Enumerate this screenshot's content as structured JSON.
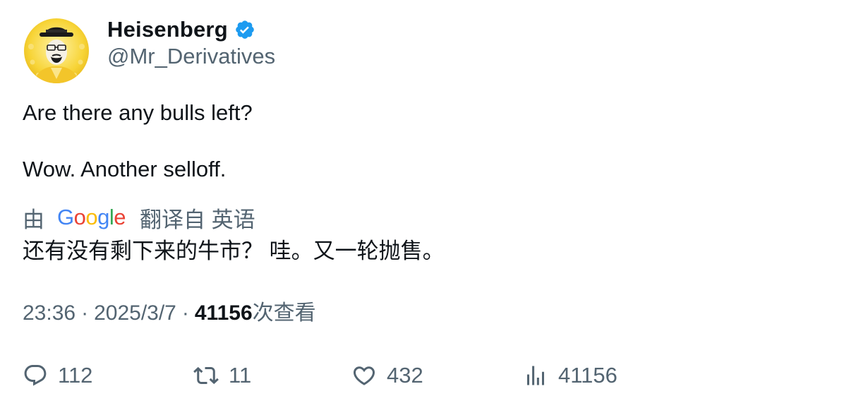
{
  "author": {
    "display_name": "Heisenberg",
    "handle": "@Mr_Derivatives",
    "verified": true,
    "avatar": "heisenberg-avatar"
  },
  "tweet": {
    "lines": [
      "Are there any bulls left?",
      "Wow. Another selloff."
    ]
  },
  "translation": {
    "prefix": "由",
    "provider": "Google",
    "suffix": "翻译自 英语",
    "text": "还有没有剩下来的牛市？ 哇。又一轮抛售。"
  },
  "meta": {
    "time": "23:36",
    "separator": "·",
    "date": "2025/3/7",
    "views_count": "41156",
    "views_label": "次查看"
  },
  "actions": {
    "replies": "112",
    "retweets": "11",
    "likes": "432",
    "views": "41156"
  },
  "colors": {
    "primary_text": "#0f1419",
    "secondary_text": "#536471",
    "verified_badge": "#1d9bf0",
    "google_blue": "#4285F4",
    "google_red": "#EA4335",
    "google_yellow": "#FBBC05",
    "google_green": "#34A853"
  }
}
